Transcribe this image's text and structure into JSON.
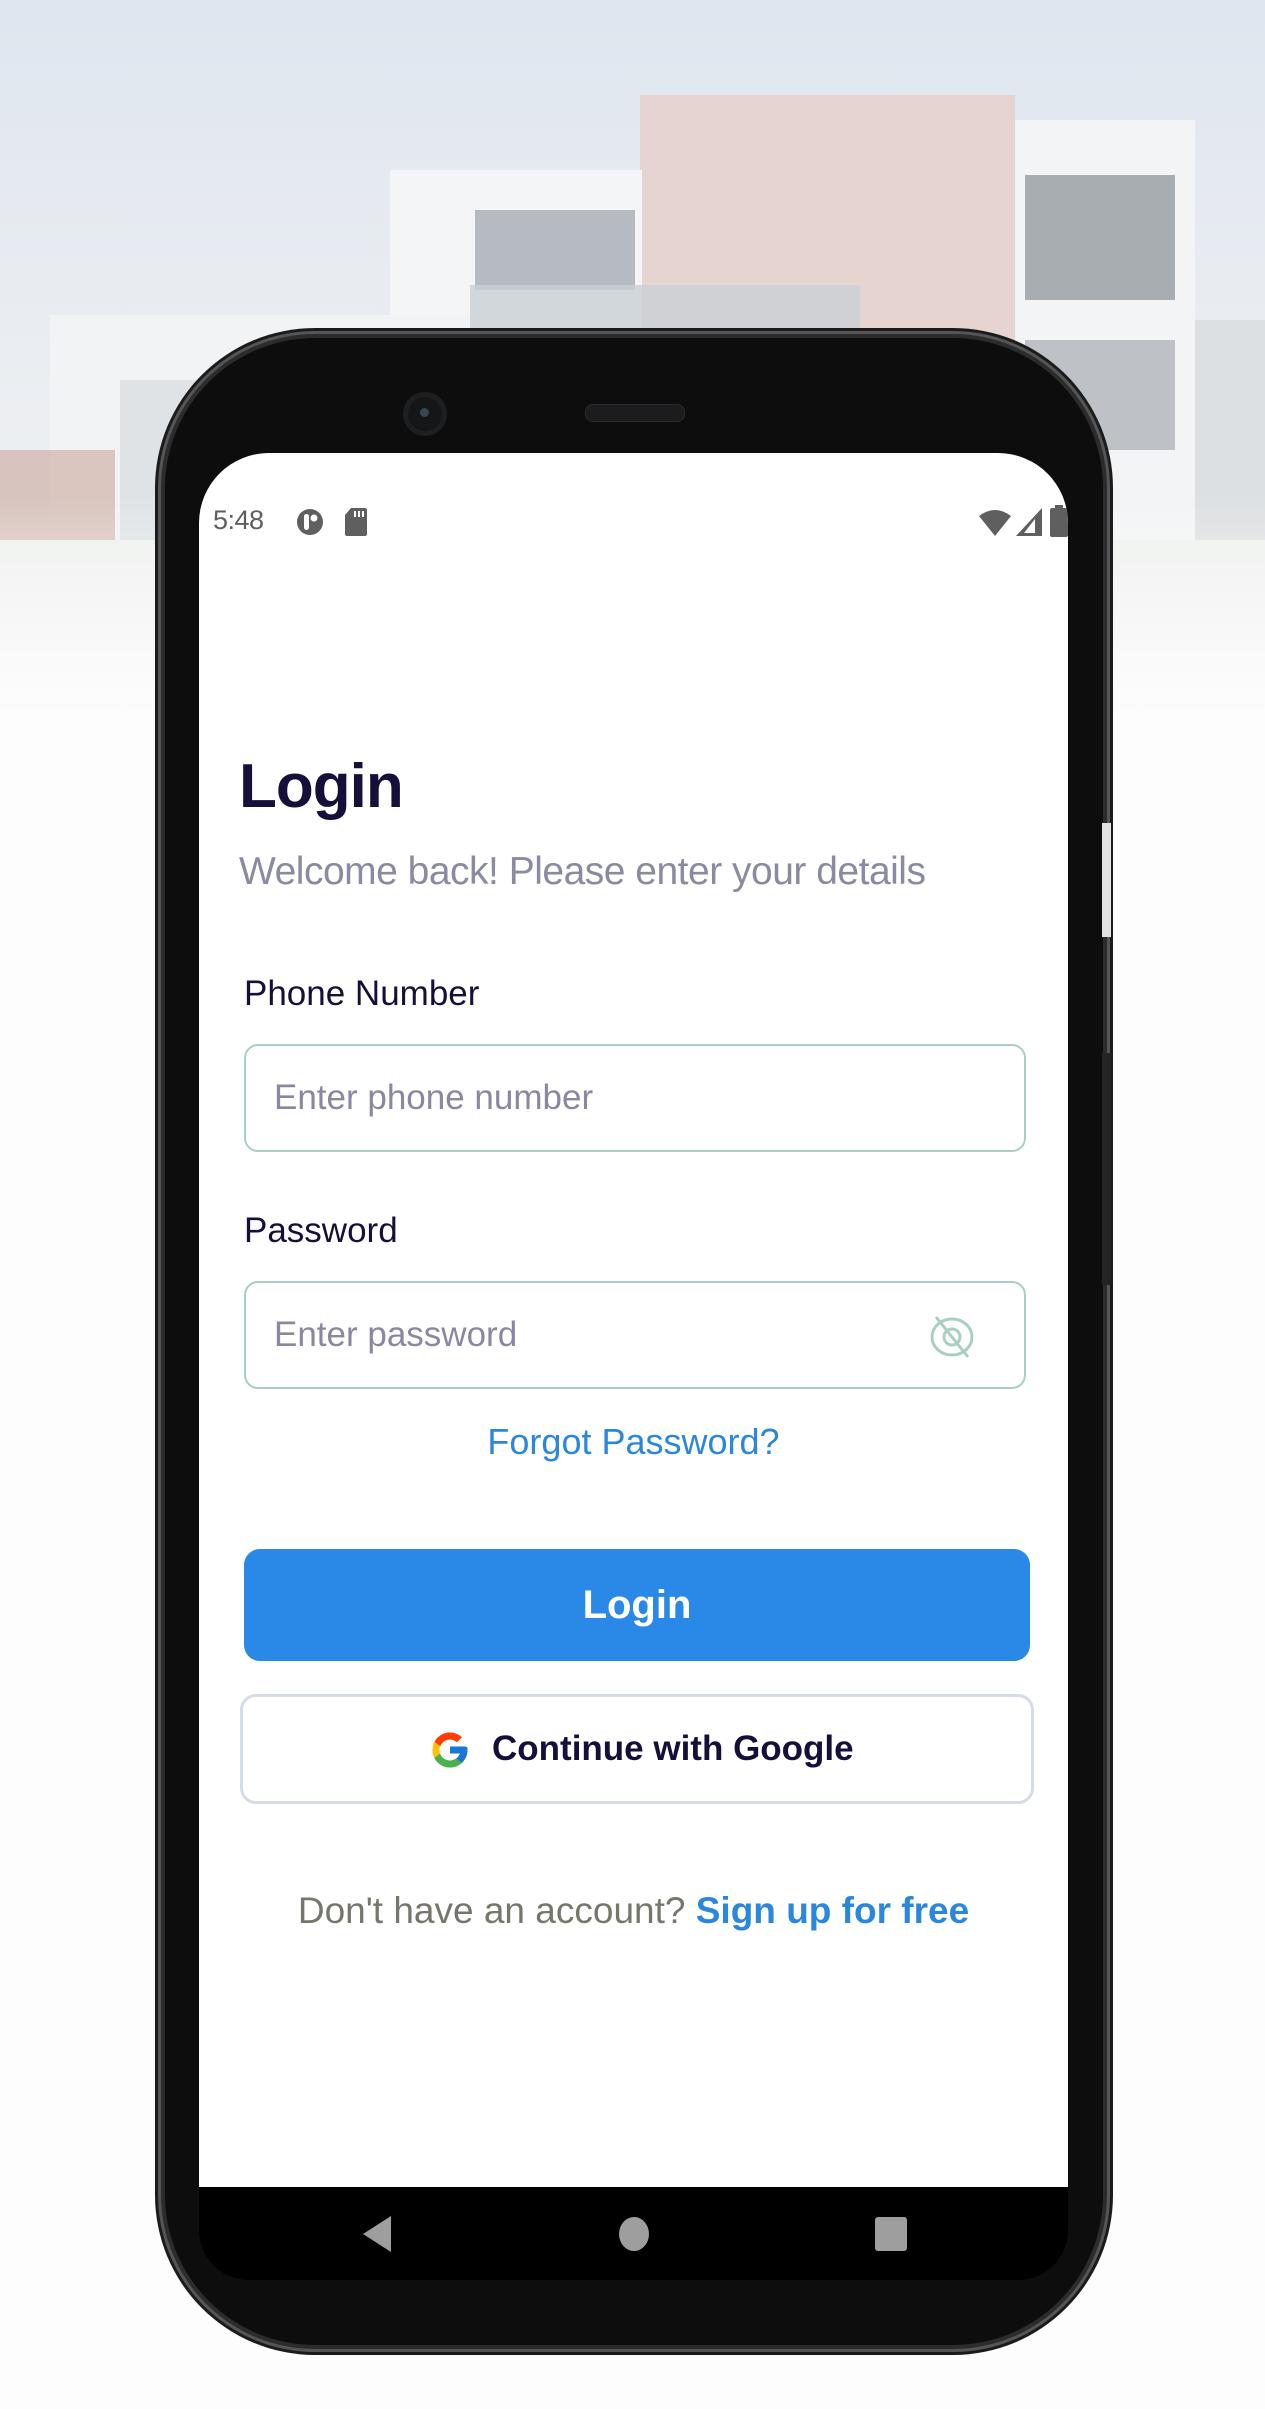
{
  "status_bar": {
    "time": "5:48",
    "left_icons": [
      "data-saver-icon",
      "sd-card-icon"
    ],
    "right_icons": [
      "wifi-icon",
      "signal-icon",
      "battery-icon"
    ]
  },
  "login": {
    "title": "Login",
    "subtitle": "Welcome back! Please enter your details",
    "phone": {
      "label": "Phone Number",
      "value": "",
      "placeholder": "Enter phone number"
    },
    "password": {
      "label": "Password",
      "value": "",
      "placeholder": "Enter password",
      "visibility_icon": "eye-off-icon"
    },
    "forgot_password": "Forgot Password?",
    "login_button": "Login",
    "google_button": "Continue with Google",
    "signup_prompt": "Don't have an account?",
    "signup_link": "Sign up for free"
  },
  "nav_bar": {
    "buttons": [
      "back",
      "home",
      "recents"
    ]
  },
  "colors": {
    "primary": "#2a88e6",
    "link": "#2b86dd",
    "title_text": "#150f3a",
    "input_border": "#a9cfc3",
    "subtitle": "#8a8aa0"
  }
}
